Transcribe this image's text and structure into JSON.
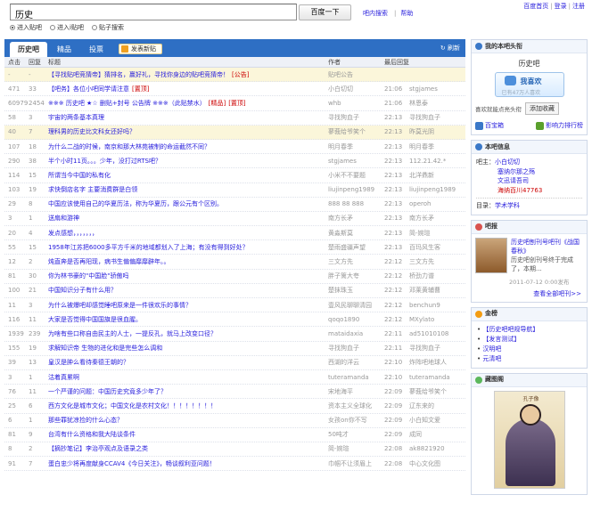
{
  "search": {
    "value": "历史",
    "button": "百度一下"
  },
  "toplinks": [
    "吧内搜索",
    "帮助"
  ],
  "userlinks": [
    "百度首页",
    "登录",
    "注册"
  ],
  "radios": [
    {
      "label": "进入贴吧",
      "checked": true
    },
    {
      "label": "进入i贴吧",
      "checked": false
    },
    {
      "label": "贴子搜索",
      "checked": false
    }
  ],
  "tabs": [
    "历史吧",
    "精品",
    "投票"
  ],
  "post_tab": "发表新贴",
  "refresh": "刷新",
  "columns": [
    "点击",
    "回复",
    "标题",
    "作者",
    "最后回复"
  ],
  "rows": [
    {
      "clicks": "-",
      "replies": "-",
      "title": "【寻找贴吧竞猜帝】猜排名，赢好礼，寻找你身边的贴吧竞猜帝！",
      "tags": [
        "公告"
      ],
      "author": "贴吧公告",
      "time": "",
      "last": "",
      "hl": true
    },
    {
      "clicks": "471",
      "replies": "33",
      "title": "【吧务】各位小吧同学请注意",
      "tags": [
        "置顶"
      ],
      "author": "小白切切",
      "time": "21:06",
      "last": "stgjames",
      "hl": false
    },
    {
      "clicks": "60979",
      "replies": "2454",
      "title": "※※※ 历史吧 ★☆ 删贴+封号 公告牌 ※※※（此贴禁水）",
      "tags": [
        "精品",
        "置顶"
      ],
      "author": "whb",
      "time": "21:06",
      "last": "林恩泰",
      "hl": false
    },
    {
      "clicks": "58",
      "replies": "3",
      "title": "宇宙的两条基本真理",
      "tags": [],
      "author": "寻找狗血子",
      "time": "22:13",
      "last": "寻找狗血子",
      "hl": false
    },
    {
      "clicks": "40",
      "replies": "7",
      "title": "理科男的历史比文科女还好吗？",
      "tags": [],
      "author": "蓼莪给爷笑个",
      "time": "22:13",
      "last": "昨莫光阴",
      "hl": true
    },
    {
      "clicks": "107",
      "replies": "18",
      "title": "为什么二战的时候，南京和那大林苑被制的命运截然不同？",
      "tags": [],
      "author": "明月春季",
      "time": "22:13",
      "last": "明月春季",
      "hl": false
    },
    {
      "clicks": "290",
      "replies": "38",
      "title": "半个小时11页。。。少年，没打过RTS吧？",
      "tags": [],
      "author": "stgjames",
      "time": "22:13",
      "last": "112.21.42.*",
      "hl": false
    },
    {
      "clicks": "114",
      "replies": "15",
      "title": "所谓当今中国的私有化",
      "tags": [],
      "author": "小米不不要题",
      "time": "22:13",
      "last": "北洋鼎新",
      "hl": false
    },
    {
      "clicks": "103",
      "replies": "19",
      "title": "求快倒店名字 主要消费群是白领",
      "tags": [],
      "author": "liujinpeng1989",
      "time": "22:13",
      "last": "liujinpeng1989",
      "hl": false
    },
    {
      "clicks": "29",
      "replies": "8",
      "title": "中国应该使用自己的华夏历法，称为华夏历，跟公元有个区别。",
      "tags": [],
      "author": "888 88 888",
      "time": "22:13",
      "last": "operoh",
      "hl": false
    },
    {
      "clicks": "3",
      "replies": "1",
      "title": "送扇和游神",
      "tags": [],
      "author": "南方长矛",
      "time": "22:13",
      "last": "南方长矛",
      "hl": false
    },
    {
      "clicks": "20",
      "replies": "4",
      "title": "发点感想，，，，，，，",
      "tags": [],
      "author": "黄淼斯莫",
      "time": "22:13",
      "last": "简-婉瑄",
      "hl": false
    },
    {
      "clicks": "55",
      "replies": "15",
      "title": "1958年江苏把6000多平方千米的地域都划入了上海；有没有得到好处？",
      "tags": [],
      "author": "楚雨盛疆声望",
      "time": "22:13",
      "last": "百玛风生客",
      "hl": false
    },
    {
      "clicks": "12",
      "replies": "2",
      "title": "炖直奔是否再阳现，病书生偏偏靡靡辟年。。",
      "tags": [],
      "author": "三文方先",
      "time": "22:12",
      "last": "三文方先",
      "hl": false
    },
    {
      "clicks": "81",
      "replies": "30",
      "title": "你为林书豪的\"中国脸\"骄傲吗",
      "tags": [],
      "author": "胖子篱大夸",
      "time": "22:12",
      "last": "桥劲力谱",
      "hl": false
    },
    {
      "clicks": "100",
      "replies": "21",
      "title": "中国知识分子有什么用？",
      "tags": [],
      "author": "楚抹珠玉",
      "time": "22:12",
      "last": "邓莱黄辅曹",
      "hl": false
    },
    {
      "clicks": "11",
      "replies": "3",
      "title": "为什么被爆吧却感觉睡吧原来是一件很欢乐的事情？",
      "tags": [],
      "author": "壹风民聊聊清园",
      "time": "22:12",
      "last": "benchun9",
      "hl": false
    },
    {
      "clicks": "116",
      "replies": "11",
      "title": "大家是否觉得中国国旗是很血腥。",
      "tags": [],
      "author": "qoqo1890",
      "time": "22:12",
      "last": "MXylato",
      "hl": false
    },
    {
      "clicks": "1939",
      "replies": "239",
      "title": "为啥有些口称自由民主的人士，一提反孔，就马上改变口径？",
      "tags": [],
      "author": "mataidaxia",
      "time": "22:11",
      "last": "ad51010108",
      "hl": false
    },
    {
      "clicks": "155",
      "replies": "19",
      "title": "求解知识帝 生物的进化和是完些怎么调和",
      "tags": [],
      "author": "寻找狗血子",
      "time": "22:11",
      "last": "寻找狗血子",
      "hl": false
    },
    {
      "clicks": "39",
      "replies": "13",
      "title": "皇汉是肿么看待秦德王朝的？",
      "tags": [],
      "author": "西湖的洋云",
      "time": "22:10",
      "last": "炸阵吧地球人",
      "hl": false
    },
    {
      "clicks": "3",
      "replies": "1",
      "title": "沽着真累啊",
      "tags": [],
      "author": "tuteramanda",
      "time": "22:10",
      "last": "tuteramanda",
      "hl": false
    },
    {
      "clicks": "76",
      "replies": "11",
      "title": "一个严谨的问题：中国历史究竟多少年了？",
      "tags": [],
      "author": "宋地海平",
      "time": "22:09",
      "last": "蓼莪给爷笑个",
      "hl": false
    },
    {
      "clicks": "25",
      "replies": "6",
      "title": "西方文化是城市文化；中国文化是农村文化！！！！！！！！",
      "tags": [],
      "author": "资本主义全球化",
      "time": "22:09",
      "last": "辽东来的",
      "hl": false
    },
    {
      "clicks": "6",
      "replies": "1",
      "title": "那些罪犹凉捡的什么心态？",
      "tags": [],
      "author": "女孩on你不写",
      "time": "22:09",
      "last": "小白知文爱",
      "hl": false
    },
    {
      "clicks": "81",
      "replies": "9",
      "title": "台湾有什么资格和我大陆谈条件",
      "tags": [],
      "author": "50吨才",
      "time": "22:09",
      "last": "成同",
      "hl": false
    },
    {
      "clicks": "8",
      "replies": "2",
      "title": "【摘抄笔记】李治亭观点及语录之类",
      "tags": [],
      "author": "简-婉瑄",
      "time": "22:08",
      "last": "ak8821920",
      "hl": false
    },
    {
      "clicks": "91",
      "replies": "7",
      "title": "蛋白忠少将再度献身CCAV4《今日关注》，畅谈叙利亚问题！",
      "tags": [],
      "author": "巾帼不让须眉上",
      "time": "22:08",
      "last": "中心文化图",
      "hl": false
    }
  ],
  "sidebar": {
    "headline_box": {
      "title": "我的本吧头衔",
      "bar_name": "历史吧",
      "like_label": "我喜欢",
      "like_sub": "已有47万人喜欢",
      "fav_text": "喜欢就能点亮头衔",
      "fav_button": "添加收藏",
      "link1": "百宝箱",
      "link2": "影响力排行榜"
    },
    "info_box": {
      "title": "本吧信息",
      "owner_label": "吧主：",
      "owners": [
        "小白切切",
        "塞纳尔那之殇",
        "文迅请吾司",
        "海纳百川47763"
      ],
      "dir_label": "目录：",
      "dir_value": "学术学科"
    },
    "news_box": {
      "title": "吧报",
      "headline": "历史吧刨刊号吧刊《战国春秋》",
      "body": "历史吧创刊号终于完成了，本期...",
      "date": "2011-07-12 0:00发布",
      "more": "查看全部吧刊>>"
    },
    "gold_box": {
      "title": "金榜",
      "items": [
        "【历史吧吧规导航】",
        "【发言测试】",
        "汉明吧",
        "元清吧"
      ]
    },
    "painting_box": {
      "title": "藏图阁",
      "seal": "孔子像"
    }
  }
}
